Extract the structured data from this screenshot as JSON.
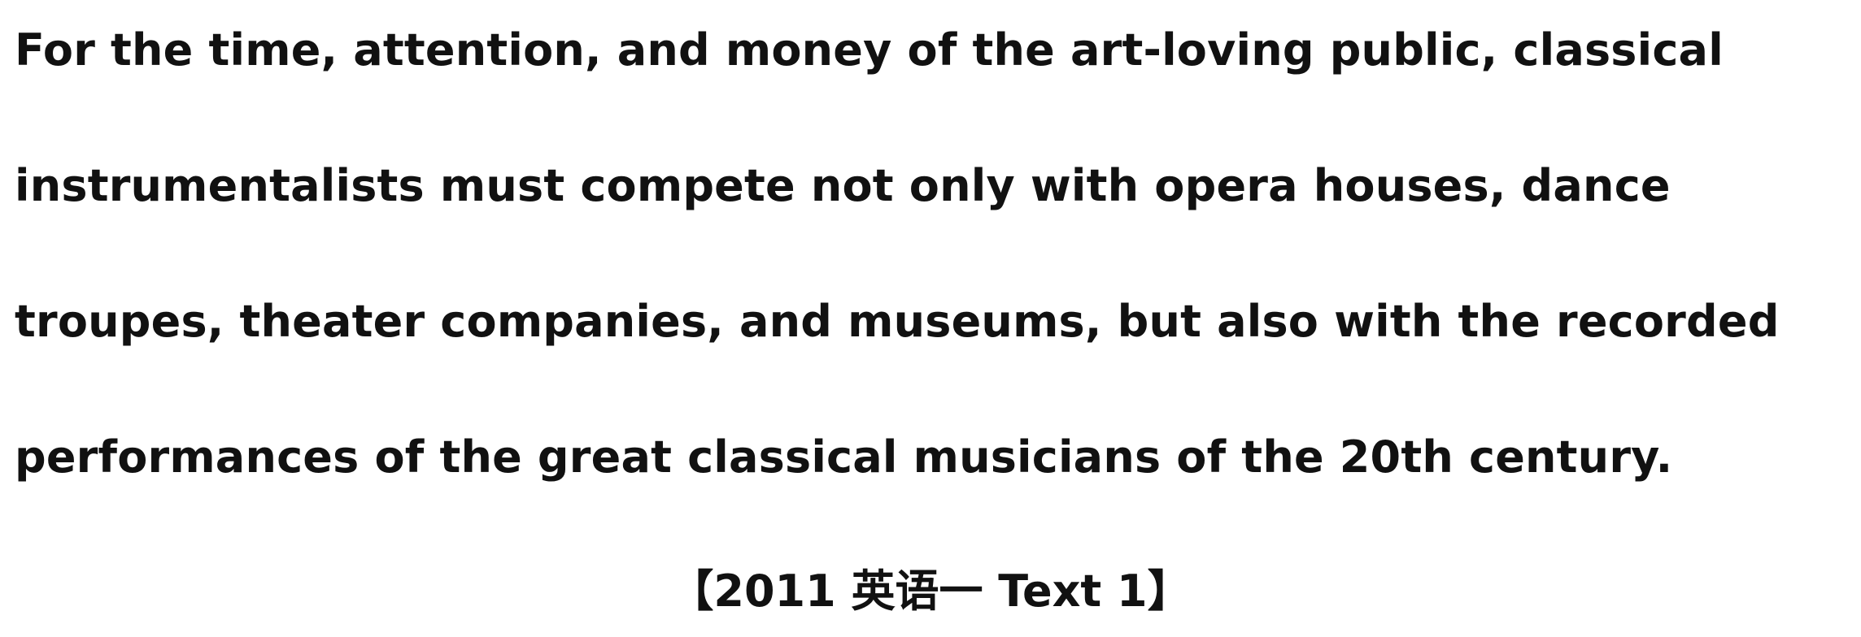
{
  "passage": {
    "lines": [
      "For the time, attention, and money of the art-loving public, classical",
      "instrumentalists must compete not only with opera houses, dance",
      "troupes, theater companies, and museums, but also with the recorded",
      "performances of the great classical musicians of the 20th century."
    ]
  },
  "source": {
    "label": "【2011 英语一 Text 1】"
  },
  "colors": {
    "background": "#ffffff",
    "text": "#111111"
  }
}
